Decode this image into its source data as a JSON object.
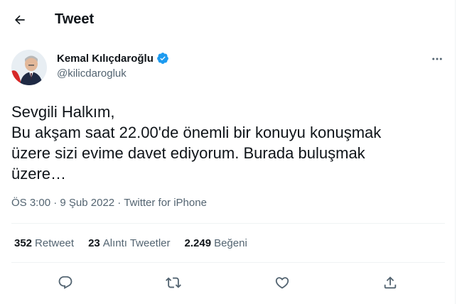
{
  "header": {
    "title": "Tweet",
    "back_icon": "arrow-left-icon"
  },
  "author": {
    "name": "Kemal Kılıçdaroğlu",
    "handle": "@kilicdarogluk",
    "verified": true
  },
  "tweet": {
    "text": "Sevgili Halkım,\nBu akşam saat 22.00'de önemli bir konuyu konuşmak\nüzere sizi evime davet ediyorum. Burada buluşmak\nüzere…",
    "time": "ÖS 3:00",
    "separator1": " · ",
    "date": "9 Şub 2022",
    "separator2": " · ",
    "source": "Twitter for iPhone"
  },
  "stats": {
    "retweets": {
      "count": "352",
      "label": "Retweet"
    },
    "quotes": {
      "count": "23",
      "label": "Alıntı Tweetler"
    },
    "likes": {
      "count": "2.249",
      "label": "Beğeni"
    }
  },
  "actions": [
    "reply-icon",
    "retweet-icon",
    "like-icon",
    "share-icon"
  ],
  "colors": {
    "text": "#0f1419",
    "secondary": "#536471",
    "verified": "#1d9bf0",
    "divider": "#eff3f4"
  }
}
